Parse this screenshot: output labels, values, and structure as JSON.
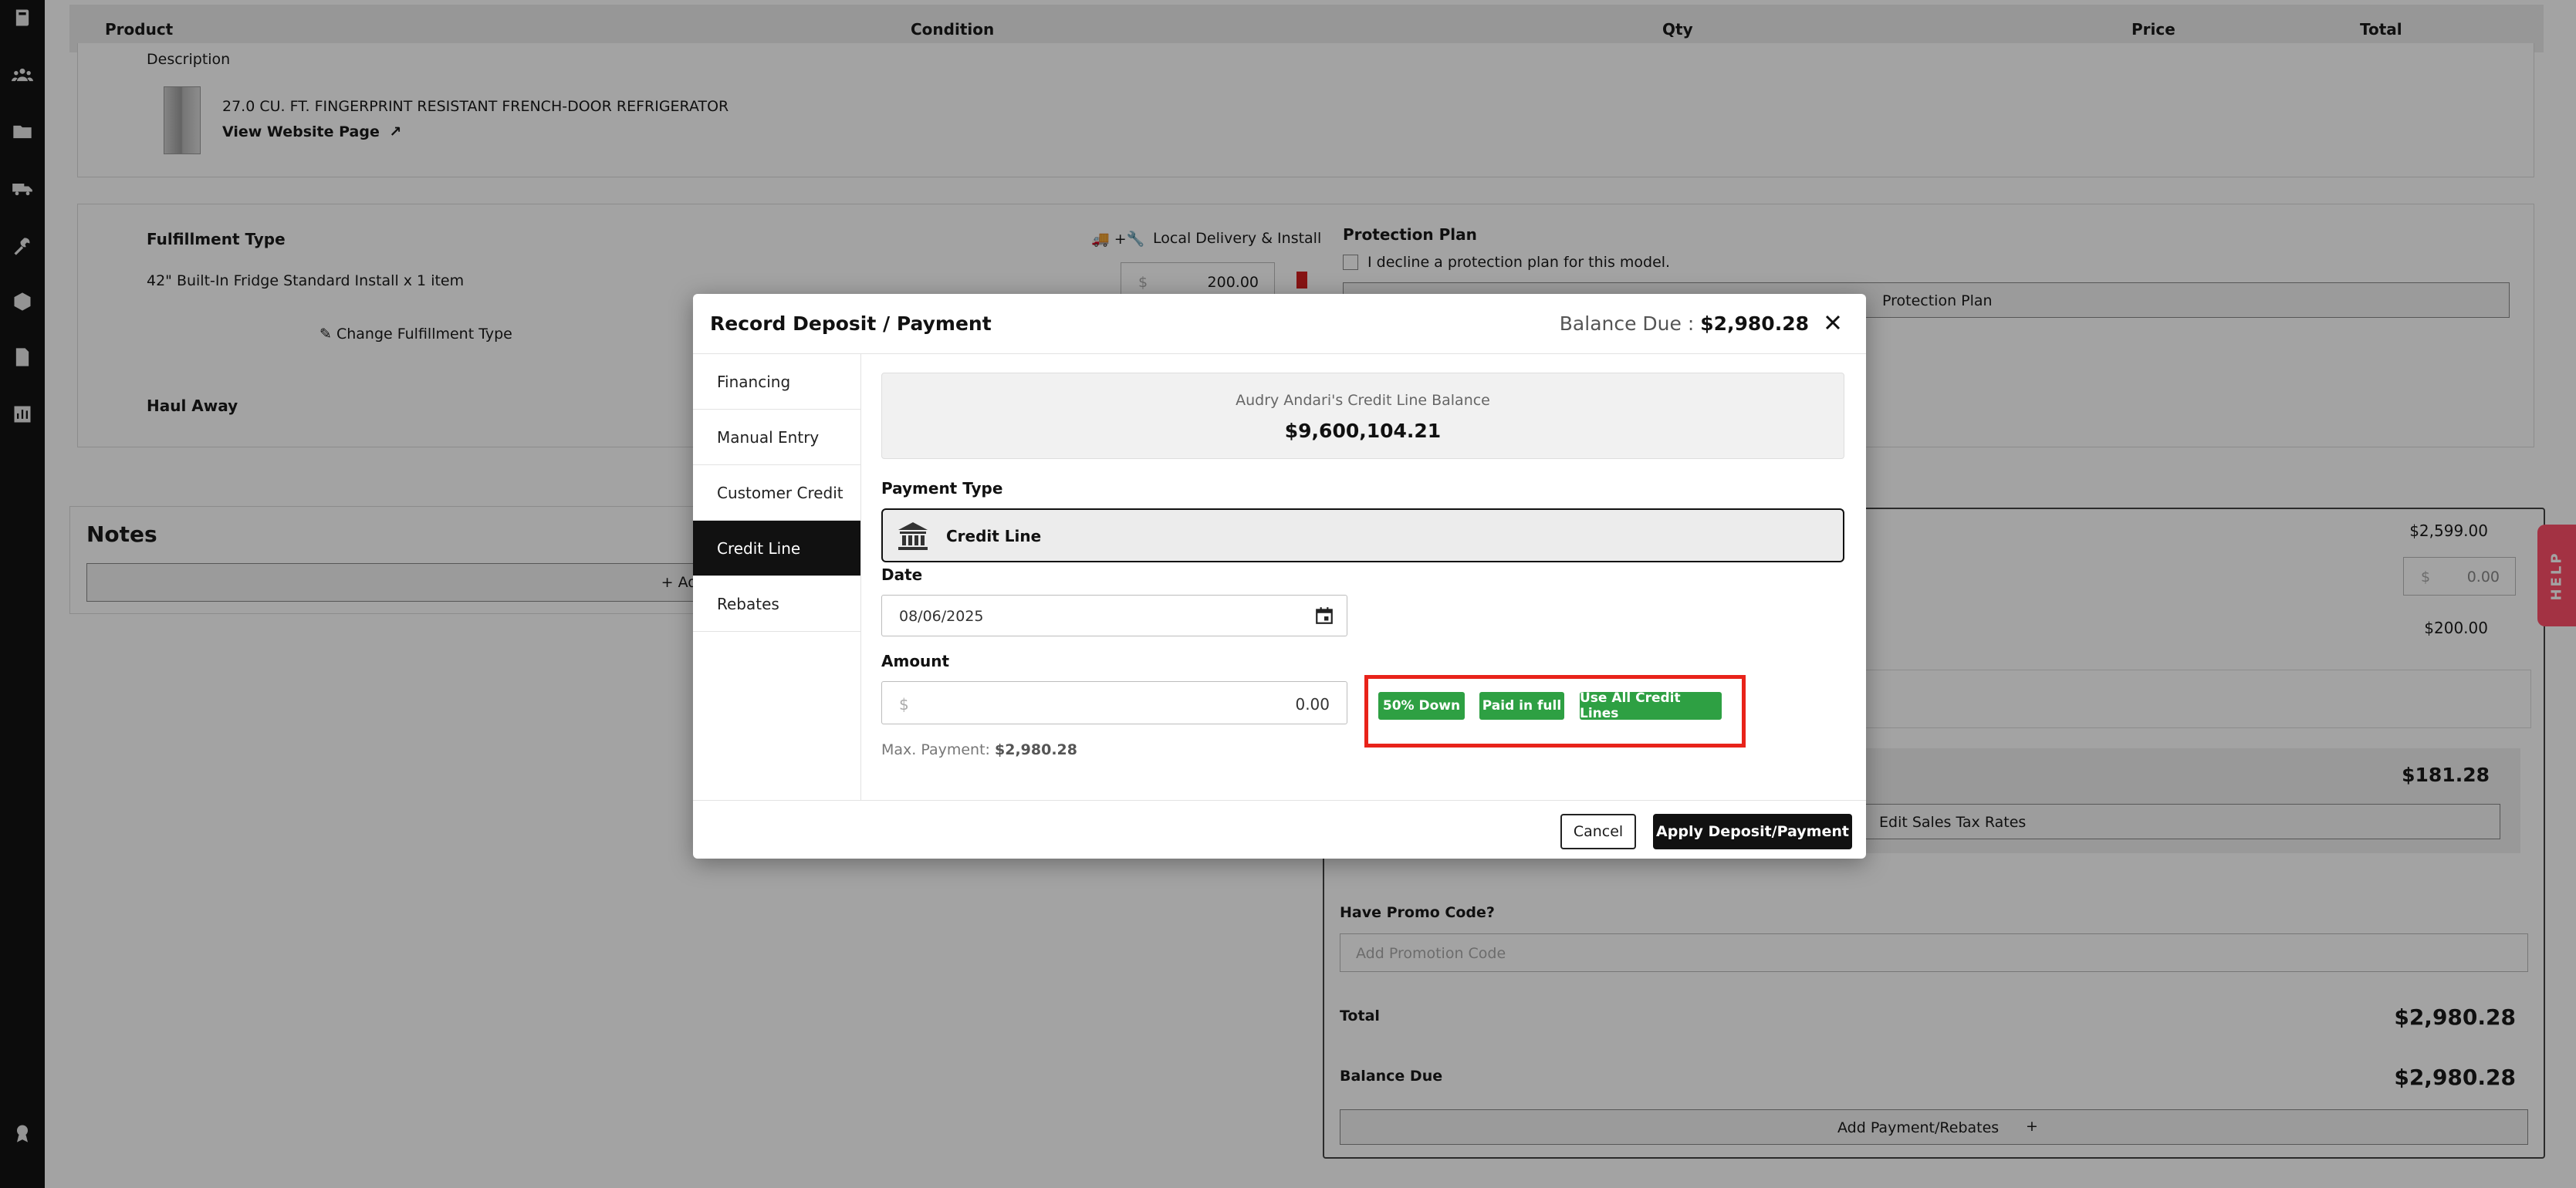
{
  "table_header": {
    "product": "Product",
    "condition": "Condition",
    "qty": "Qty",
    "price": "Price",
    "total": "Total"
  },
  "product": {
    "description_label": "Description",
    "name": "27.0 CU. FT. FINGERPRINT RESISTANT FRENCH-DOOR REFRIGERATOR",
    "website_link": "View Website Page"
  },
  "fulfillment": {
    "label": "Fulfillment Type",
    "delivery_type": "Local Delivery & Install",
    "item": "42\" Built-In Fridge Standard Install x 1 item",
    "price_prefix": "$",
    "price": "200.00",
    "change_label": "Change Fulfillment Type",
    "haul_away": "Haul Away"
  },
  "protection": {
    "label": "Protection Plan",
    "decline": "I decline a protection plan for this model.",
    "button": "Protection Plan"
  },
  "notes": {
    "title": "Notes",
    "add_label": "Add No"
  },
  "summary": {
    "subtotal": "$2,599.00",
    "discount_prefix": "$",
    "discount": "0.00",
    "fulfillment_total": "$200.00",
    "tax": "$181.28",
    "edit_tax": "Edit Sales Tax Rates",
    "promo_label": "Have Promo Code?",
    "promo_placeholder": "Add Promotion Code",
    "total_label": "Total",
    "total": "$2,980.28",
    "balance_label": "Balance Due",
    "balance": "$2,980.28",
    "add_payment": "Add Payment/Rebates"
  },
  "help": "HELP",
  "modal": {
    "title": "Record Deposit / Payment",
    "balance_label": "Balance Due :",
    "balance_value": "$2,980.28",
    "tabs": [
      "Financing",
      "Manual Entry",
      "Customer Credit",
      "Credit Line",
      "Rebates"
    ],
    "active_tab": "Credit Line",
    "credit_line_name": "Audry Andari's Credit Line Balance",
    "credit_line_balance": "$9,600,104.21",
    "payment_type_label": "Payment Type",
    "payment_type_value": "Credit Line",
    "date_label": "Date",
    "date_value": "08/06/2025",
    "amount_label": "Amount",
    "amount_prefix": "$",
    "amount_value": "0.00",
    "max_payment_label": "Max. Payment:",
    "max_payment_value": "$2,980.28",
    "quick_buttons": [
      "50% Down",
      "Paid in full",
      "Use All Credit Lines"
    ],
    "cancel": "Cancel",
    "apply": "Apply Deposit/Payment"
  },
  "colors": {
    "accent_green": "#2ea043",
    "highlight_red": "#e8231a",
    "help_pink": "#ff4f6a",
    "active_tab": "#111111"
  }
}
